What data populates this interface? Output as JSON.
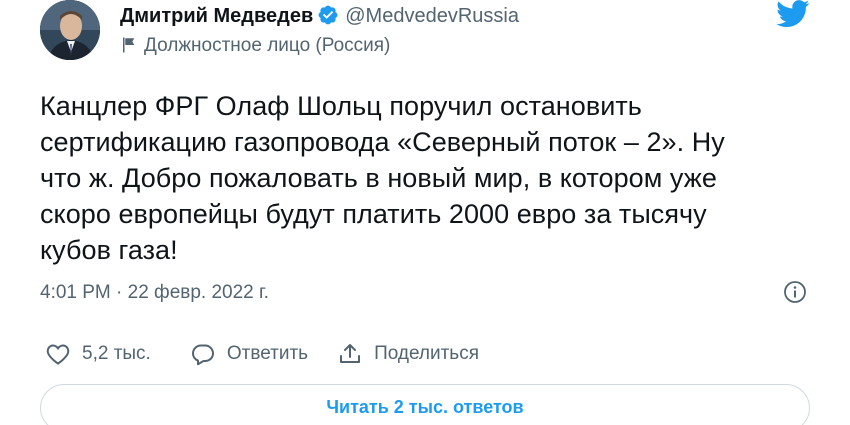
{
  "author": {
    "name": "Дмитрий Медведев",
    "handle": "@MedvedevRussia",
    "label": "Должностное лицо (Россия)",
    "verified_icon": "verified-badge-icon",
    "label_icon": "government-flag-icon"
  },
  "tweet": {
    "text": "Канцлер ФРГ Олаф Шольц поручил остановить\nсертификацию газопровода «Северный поток – 2». Ну\nчто ж. Добро пожаловать в новый мир, в котором уже\nскоро европейцы будут платить 2000 евро за тысячу\nкубов газа!",
    "timestamp": "4:01 PM · 22 февр. 2022 г."
  },
  "actions": {
    "likes_count": "5,2 тыс.",
    "reply_label": "Ответить",
    "share_label": "Поделиться"
  },
  "read_replies_label": "Читать 2 тыс. ответов",
  "colors": {
    "accent": "#1d9bf0",
    "text": "#0f1419",
    "secondary": "#536471",
    "border": "#cfd9de"
  }
}
